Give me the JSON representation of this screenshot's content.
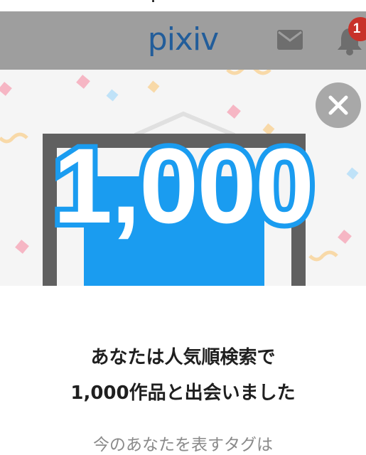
{
  "header": {
    "logo_text": "pixiv",
    "mail_icon": "mail-icon",
    "bell_icon": "bell-icon",
    "notification_count": "1",
    "badge_color": "#c8322a",
    "header_bg": "#9e9e9e"
  },
  "banner": {
    "count_text": "1,000",
    "count_outline_color": "#1a9cf0",
    "close_icon": "close-icon"
  },
  "body": {
    "headline_line1": "あなたは人気順検索で",
    "headline_line2": "1,000作品と出会いました",
    "subtext": "今のあなたを表すタグは"
  }
}
